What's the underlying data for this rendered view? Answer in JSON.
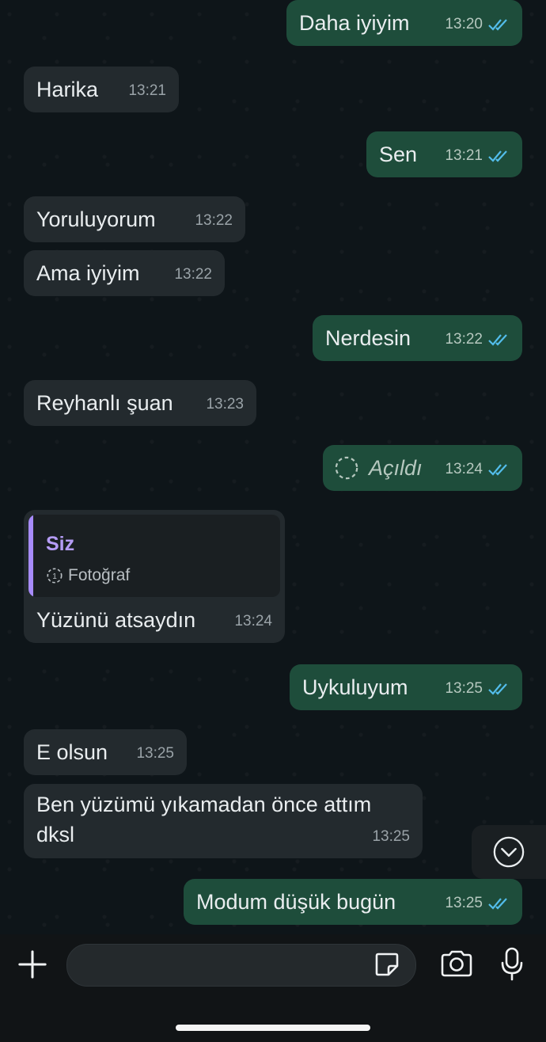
{
  "messages": [
    {
      "dir": "out",
      "text": "Daha iyiyim",
      "time": "13:20",
      "status": "read"
    },
    {
      "dir": "in",
      "text": "Harika",
      "time": "13:21"
    },
    {
      "dir": "out",
      "text": "Sen",
      "time": "13:21",
      "status": "read"
    },
    {
      "dir": "in",
      "text": "Yoruluyorum",
      "time": "13:22"
    },
    {
      "dir": "in",
      "text": "Ama iyiyim",
      "time": "13:22"
    },
    {
      "dir": "out",
      "text": "Nerdesin",
      "time": "13:22",
      "status": "read"
    },
    {
      "dir": "in",
      "text": "Reyhanlı şuan",
      "time": "13:23"
    },
    {
      "dir": "out",
      "text": "Açıldı",
      "time": "13:24",
      "status": "read",
      "view_once": true
    },
    {
      "dir": "in",
      "text": "Yüzünü atsaydın",
      "time": "13:24",
      "reply_to": {
        "author": "Siz",
        "preview": "Fotoğraf"
      }
    },
    {
      "dir": "out",
      "text": "Uykuluyum",
      "time": "13:25",
      "status": "read"
    },
    {
      "dir": "in",
      "text": "E olsun",
      "time": "13:25"
    },
    {
      "dir": "in",
      "text": "Ben yüzümü yıkamadan önce attım dksl",
      "time": "13:25"
    },
    {
      "dir": "out",
      "text": "Modum düşük bugün",
      "time": "13:25",
      "status": "read"
    }
  ],
  "colors": {
    "outgoing": "#1e4d3b",
    "incoming": "#232a2e",
    "read_ticks": "#53bdeb",
    "reply_accent": "#a78bfa"
  },
  "icons": [
    "plus-icon",
    "sticker-icon",
    "camera-icon",
    "microphone-icon",
    "chevron-down-icon",
    "double-check-icon",
    "view-once-icon"
  ]
}
